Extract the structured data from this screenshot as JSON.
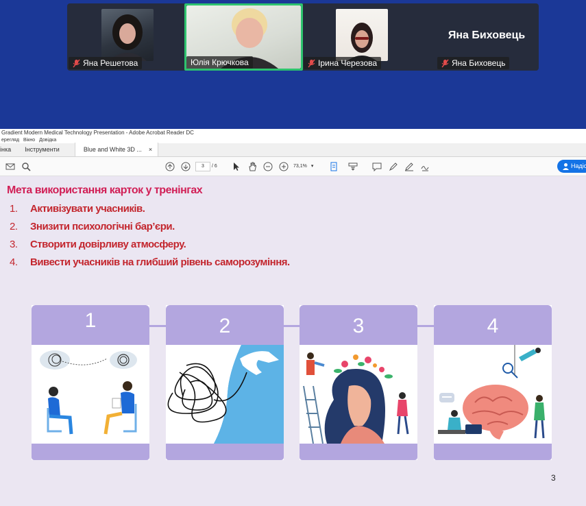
{
  "call": {
    "participants": [
      {
        "name": "Яна Решетова",
        "muted": true
      },
      {
        "name": "Юлія Крючкова",
        "muted": false,
        "active_speaker": true
      },
      {
        "name": "Ірина Черезова",
        "muted": true
      },
      {
        "name": "Яна Биховець",
        "muted": true,
        "video_off": true,
        "display_name": "Яна Биховець"
      }
    ]
  },
  "acrobat": {
    "window_title": "Gradient Modern Medical Technology Presentation - Adobe Acrobat Reader DC",
    "menu": [
      "ерегляд",
      "Вікно",
      "Довідка"
    ],
    "tabs": [
      "інка",
      "Інструменти"
    ],
    "doc_tab_label": "Blue and White 3D ...",
    "doc_tab_close": "×",
    "page_current": "3",
    "page_total": "/ 6",
    "zoom": "73,1%",
    "share_label": "Надіс"
  },
  "slide": {
    "title": "Мета використання карток у тренінгах",
    "goals": [
      {
        "num": "1.",
        "text": "Активізувати учасників."
      },
      {
        "num": "2.",
        "text": "Знизити психологічні бар’єри."
      },
      {
        "num": "3.",
        "text": "Створити довірливу атмосферу."
      },
      {
        "num": "4.",
        "text": "Вивести учасників на глибший рівень саморозуміння."
      }
    ],
    "cards": [
      "1",
      "2",
      "3",
      "4"
    ],
    "page_number": "3"
  }
}
